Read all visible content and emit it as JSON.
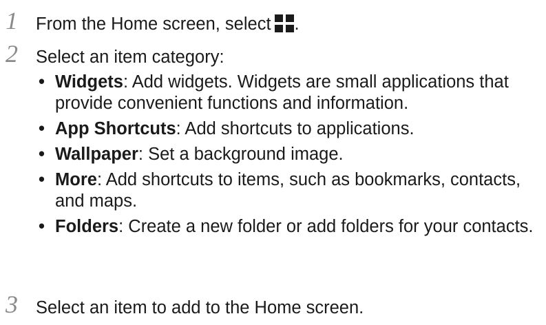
{
  "steps": [
    {
      "number": "1",
      "text_before": "From the Home screen, select",
      "icon": "plus-icon",
      "text_after": "."
    },
    {
      "number": "2",
      "text": "Select an item category:",
      "bullets": [
        {
          "term": "Widgets",
          "desc": ": Add widgets. Widgets are small applications that provide convenient functions and information."
        },
        {
          "term": "App Shortcuts",
          "desc": ": Add shortcuts to applications."
        },
        {
          "term": "Wallpaper",
          "desc": ": Set a background image."
        },
        {
          "term": "More",
          "desc": ": Add shortcuts to items, such as bookmarks, contacts, and maps."
        },
        {
          "term": "Folders",
          "desc": ": Create a new folder or add folders for your contacts."
        }
      ]
    },
    {
      "number": "3",
      "text": "Select an item to add to the Home screen."
    }
  ],
  "bullet_symbol": "•"
}
